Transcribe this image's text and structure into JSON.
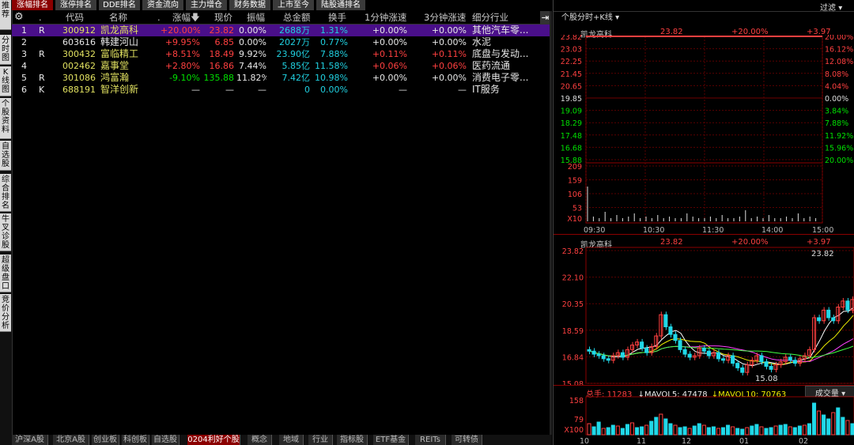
{
  "left_tabs": [
    "推荐",
    "分时图",
    "K线图",
    "个股资料",
    "自选股",
    "综合排名",
    "牛叉诊股",
    "超级盘口",
    "竞价分析"
  ],
  "top_tabs": [
    "涨幅排名",
    "涨停排名",
    "DDE排名",
    "资金流向",
    "主力增仓",
    "财务数据",
    "上市至今",
    "陆股通排名"
  ],
  "table": {
    "headers": [
      ".",
      "代码",
      "名称",
      ".",
      "涨幅",
      "现价",
      "振幅",
      "总金额",
      "换手",
      "1分钟涨速",
      "3分钟涨速",
      "细分行业"
    ],
    "rows": [
      {
        "idx": "1",
        "flag": "R",
        "code": "300912",
        "name": "凯龙高科",
        "chg": "+20.00%",
        "price": "23.82",
        "amp": "0.00%",
        "amount": "2688万",
        "turn": "1.31%",
        "s1": "+0.00%",
        "s3": "+0.00%",
        "ind": "其他汽车零..."
      },
      {
        "idx": "2",
        "flag": "",
        "code": "603616",
        "name": "韩建河山",
        "chg": "+9.95%",
        "price": "6.85",
        "amp": "0.00%",
        "amount": "2027万",
        "turn": "0.77%",
        "s1": "+0.00%",
        "s3": "+0.00%",
        "ind": "水泥"
      },
      {
        "idx": "3",
        "flag": "R",
        "code": "300432",
        "name": "富临精工",
        "chg": "+8.51%",
        "price": "18.49",
        "amp": "9.92%",
        "amount": "23.90亿",
        "turn": "7.88%",
        "s1": "+0.11%",
        "s3": "+0.11%",
        "ind": "底盘与发动..."
      },
      {
        "idx": "4",
        "flag": "",
        "code": "002462",
        "name": "嘉事堂",
        "chg": "+2.80%",
        "price": "16.86",
        "amp": "7.44%",
        "amount": "5.85亿",
        "turn": "11.58%",
        "s1": "+0.06%",
        "s3": "+0.06%",
        "ind": "医药流通"
      },
      {
        "idx": "5",
        "flag": "R",
        "code": "301086",
        "name": "鸿富瀚",
        "chg": "-9.10%",
        "price": "135.88",
        "amp": "11.82%",
        "amount": "7.42亿",
        "turn": "10.98%",
        "s1": "+0.00%",
        "s3": "+0.00%",
        "ind": "消费电子零..."
      },
      {
        "idx": "6",
        "flag": "K",
        "code": "688191",
        "name": "智洋创新",
        "chg": "—",
        "price": "—",
        "amp": "—",
        "amount": "0",
        "turn": "0.00%",
        "s1": "—",
        "s3": "—",
        "ind": "IT服务"
      }
    ]
  },
  "bottom_tabs": [
    "沪深A股",
    "北京A股",
    "创业板",
    "科创板",
    "自选股",
    "0204利好个股",
    "概念",
    "地域",
    "行业",
    "指标股",
    "ETF基金",
    "REITs",
    "可转债"
  ],
  "right": {
    "mode_select": "个股分时+K线",
    "filter_label": "过滤",
    "intraday": {
      "name": "凯龙高科",
      "price": "23.82",
      "pct": "+20.00%",
      "diff": "+3.97",
      "left_ticks": [
        "23.82",
        "23.03",
        "22.25",
        "21.45",
        "20.65",
        "19.85",
        "19.09",
        "18.29",
        "17.48",
        "16.68",
        "15.88"
      ],
      "right_ticks": [
        "20.00%",
        "16.12%",
        "12.08%",
        "8.08%",
        "4.04%",
        "0.00%",
        "3.84%",
        "7.88%",
        "11.92%",
        "15.96%",
        "20.00%"
      ],
      "vol_ticks": [
        "209",
        "159",
        "106",
        "53"
      ],
      "vol_unit": "X10",
      "time_ticks": [
        "09:30",
        "10:30",
        "11:30",
        "14:00",
        "15:00"
      ]
    },
    "kline": {
      "name": "凯龙高科",
      "price": "23.82",
      "pct": "+20.00%",
      "diff": "+3.97",
      "left_ticks": [
        "23.82",
        "22.10",
        "20.35",
        "18.59",
        "16.84",
        "15.08"
      ],
      "high_label": "23.82",
      "low_label": "15.08",
      "vol_line": {
        "total_label": "总手:",
        "total": "11283",
        "ma5_label": "↓MAVOL5:",
        "ma5": "47478",
        "ma10_label": "↓MAVOL10:",
        "ma10": "70763"
      },
      "vol_select": "成交量",
      "vol_ticks": [
        "158",
        "79"
      ],
      "vol_unit": "X100",
      "date_ticks": [
        "10",
        "11",
        "12",
        "01",
        "02"
      ]
    }
  },
  "colors": {
    "up": "#ff4040",
    "down": "#00e000",
    "selected_row": "#4a0f8a",
    "active_tab": "#8b0000"
  }
}
